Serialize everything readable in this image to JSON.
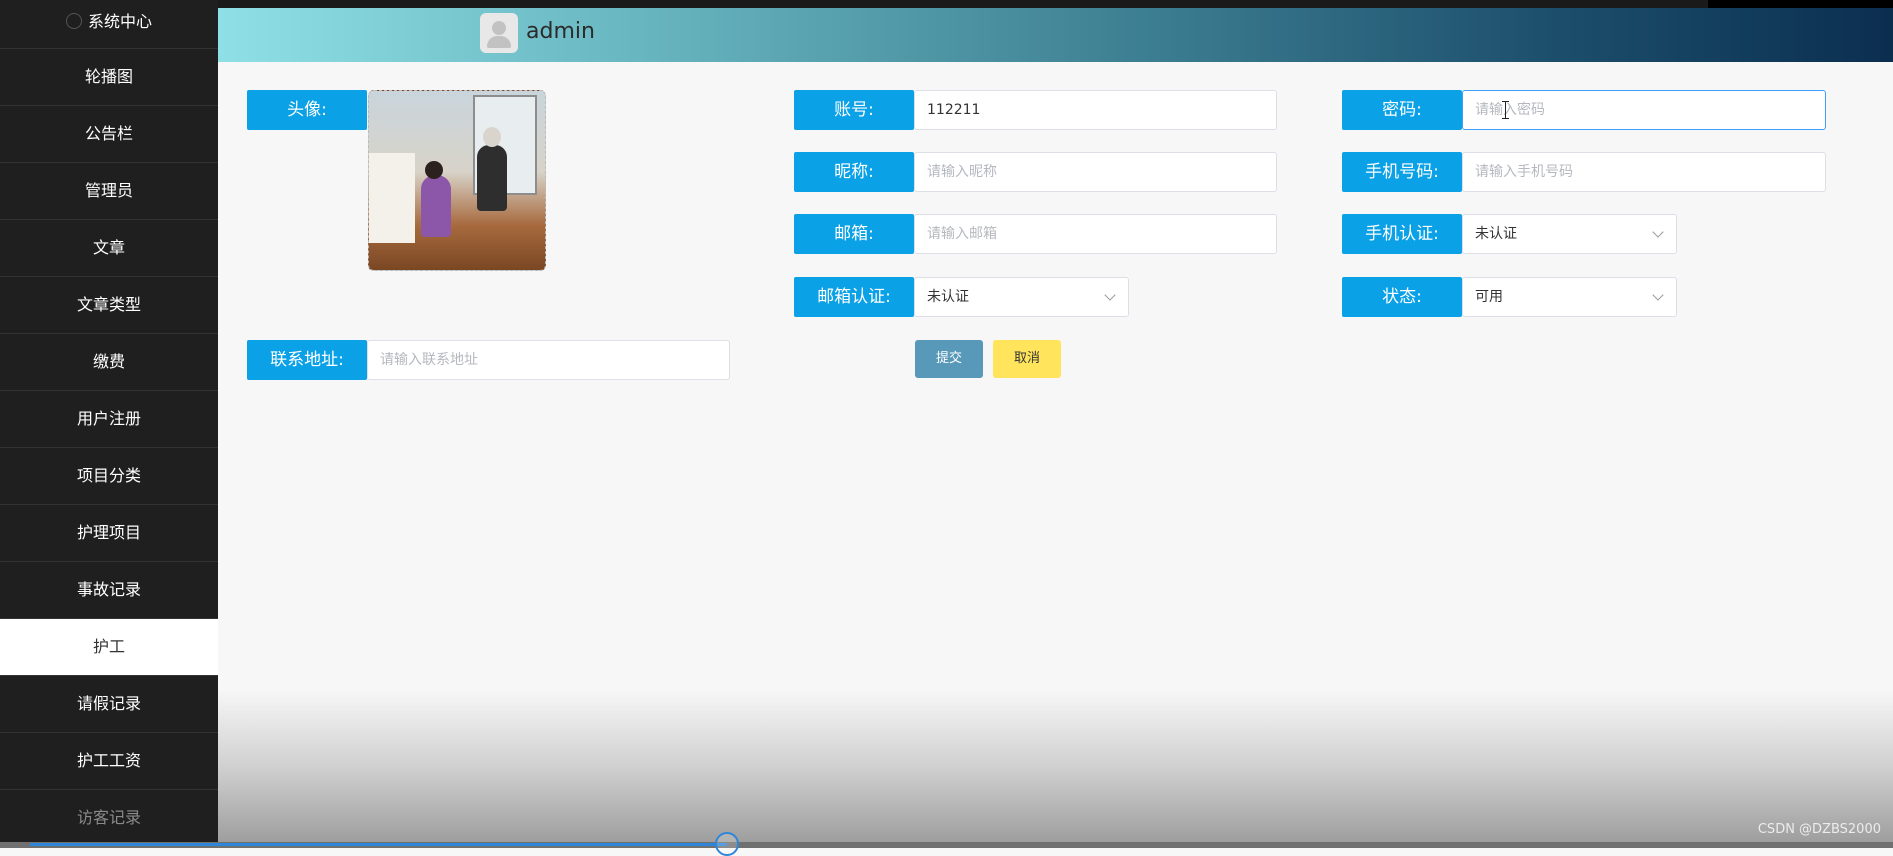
{
  "header": {
    "username": "admin"
  },
  "sidebar": {
    "items": [
      {
        "label": "系统中心"
      },
      {
        "label": "轮播图"
      },
      {
        "label": "公告栏"
      },
      {
        "label": "管理员"
      },
      {
        "label": "文章"
      },
      {
        "label": "文章类型"
      },
      {
        "label": "缴费"
      },
      {
        "label": "用户注册"
      },
      {
        "label": "项目分类"
      },
      {
        "label": "护理项目"
      },
      {
        "label": "事故记录"
      },
      {
        "label": "护工"
      },
      {
        "label": "请假记录"
      },
      {
        "label": "护工工资"
      },
      {
        "label": "访客记录"
      }
    ],
    "active_label": "护工"
  },
  "form": {
    "avatar_label": "头像:",
    "account_label": "账号:",
    "account_value": "112211",
    "password_label": "密码:",
    "password_placeholder": "请输入密码",
    "nickname_label": "昵称:",
    "nickname_placeholder": "请输入昵称",
    "phone_label": "手机号码:",
    "phone_placeholder": "请输入手机号码",
    "email_label": "邮箱:",
    "email_placeholder": "请输入邮箱",
    "phone_verify_label": "手机认证:",
    "phone_verify_value": "未认证",
    "email_verify_label": "邮箱认证:",
    "email_verify_value": "未认证",
    "status_label": "状态:",
    "status_value": "可用",
    "address_label": "联系地址:",
    "address_placeholder": "请输入联系地址",
    "submit_label": "提交",
    "cancel_label": "取消"
  },
  "video": {
    "progress": 0.38
  },
  "watermark": "CSDN @DZBS2000",
  "colors": {
    "label_bg": "#0aa1e6",
    "submit_bg": "#5898b8",
    "cancel_bg": "#ffe45c",
    "sidebar_bg": "#1f1f1f"
  }
}
